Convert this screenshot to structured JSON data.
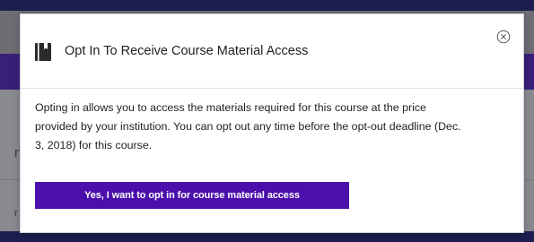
{
  "modal": {
    "title": "Opt In To Receive Course Material Access",
    "body": "Opting in allows you to access the materials required for this course at the price provided by your institution. You can opt out any time before the opt-out deadline (Dec. 3, 2018) for this course.",
    "opt_in_button_label": "Yes, I want to opt in for course material access",
    "icons": {
      "title_icon": "book-icon",
      "close_icon": "close-circle-icon"
    }
  },
  "background_fragments": {
    "left_char_1": "n",
    "left_char_2": "r"
  },
  "colors": {
    "accent_button": "#4b0fab",
    "topbar": "#1c1f4d"
  }
}
